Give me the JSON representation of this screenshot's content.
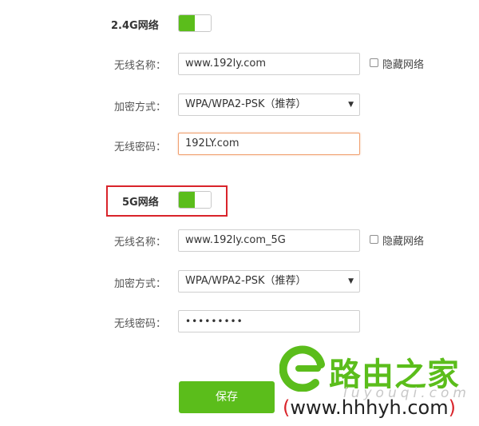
{
  "band_24g": {
    "title": "2.4G网络",
    "enabled": true,
    "ssid_label": "无线名称：",
    "ssid_value": "www.192ly.com",
    "hide_label": "隐藏网络",
    "hide_checked": false,
    "security_label": "加密方式：",
    "security_value": "WPA/WPA2-PSK（推荐）",
    "password_label": "无线密码：",
    "password_value": "192LY.com"
  },
  "band_5g": {
    "title": "5G网络",
    "enabled": true,
    "ssid_label": "无线名称：",
    "ssid_value": "www.192ly.com_5G",
    "hide_label": "隐藏网络",
    "hide_checked": false,
    "security_label": "加密方式：",
    "security_value": "WPA/WPA2-PSK（推荐）",
    "password_label": "无线密码：",
    "password_masked": "•••••••••"
  },
  "actions": {
    "save_label": "保存"
  },
  "watermark": {
    "brand_text": "路由之家",
    "sub_text": "luyouqi.com",
    "url_open": "(",
    "url_text": "www.hhhyh.com",
    "url_close": ")"
  },
  "colors": {
    "accent_green": "#5bbd1b",
    "highlight_red": "#d9242b",
    "focus_orange": "#f0a070"
  },
  "icons": [
    "chevron-down-icon",
    "logo-mark-icon"
  ]
}
